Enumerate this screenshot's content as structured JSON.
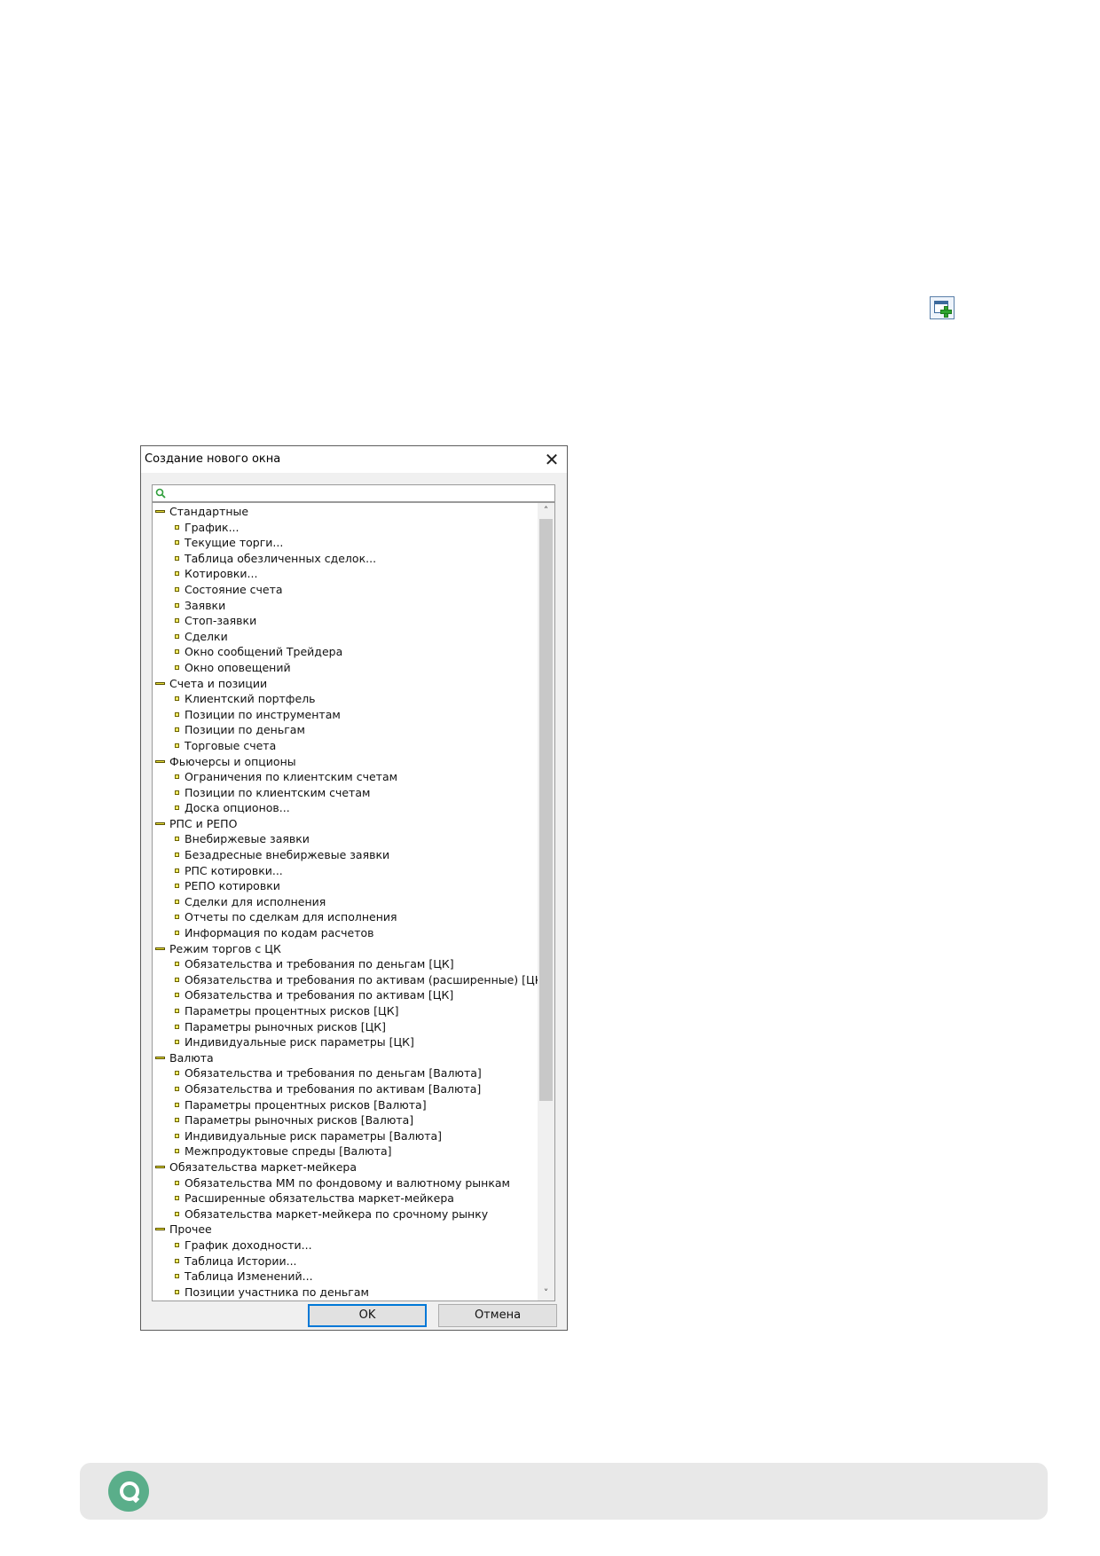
{
  "dialog": {
    "title": "Создание нового окна",
    "close_icon": "close-icon",
    "search_icon": "search-icon",
    "search_value": "",
    "ok_label": "OK",
    "cancel_label": "Отмена"
  },
  "tree": [
    {
      "type": "cat",
      "label": "Стандартные"
    },
    {
      "type": "leaf",
      "label": "График..."
    },
    {
      "type": "leaf",
      "label": "Текущие торги..."
    },
    {
      "type": "leaf",
      "label": "Таблица обезличенных сделок..."
    },
    {
      "type": "leaf",
      "label": "Котировки..."
    },
    {
      "type": "leaf",
      "label": "Состояние счета"
    },
    {
      "type": "leaf",
      "label": "Заявки"
    },
    {
      "type": "leaf",
      "label": "Стоп-заявки"
    },
    {
      "type": "leaf",
      "label": "Сделки"
    },
    {
      "type": "leaf",
      "label": "Окно сообщений Трейдера"
    },
    {
      "type": "leaf",
      "label": "Окно оповещений"
    },
    {
      "type": "cat",
      "label": "Счета и позиции"
    },
    {
      "type": "leaf",
      "label": "Клиентский портфель"
    },
    {
      "type": "leaf",
      "label": "Позиции по инструментам"
    },
    {
      "type": "leaf",
      "label": "Позиции по деньгам"
    },
    {
      "type": "leaf",
      "label": "Торговые счета"
    },
    {
      "type": "cat",
      "label": "Фьючерсы и опционы"
    },
    {
      "type": "leaf",
      "label": "Ограничения по клиентским счетам"
    },
    {
      "type": "leaf",
      "label": "Позиции по клиентским счетам"
    },
    {
      "type": "leaf",
      "label": "Доска опционов..."
    },
    {
      "type": "cat",
      "label": "РПС и РЕПО"
    },
    {
      "type": "leaf",
      "label": "Внебиржевые заявки"
    },
    {
      "type": "leaf",
      "label": "Безадресные внебиржевые заявки"
    },
    {
      "type": "leaf",
      "label": "РПС котировки..."
    },
    {
      "type": "leaf",
      "label": "РЕПО котировки"
    },
    {
      "type": "leaf",
      "label": "Сделки для исполнения"
    },
    {
      "type": "leaf",
      "label": "Отчеты по сделкам для исполнения"
    },
    {
      "type": "leaf",
      "label": "Информация по кодам расчетов"
    },
    {
      "type": "cat",
      "label": "Режим торгов с ЦК"
    },
    {
      "type": "leaf",
      "label": "Обязательства и требования по деньгам [ЦК]"
    },
    {
      "type": "leaf",
      "label": "Обязательства и требования по активам (расширенные) [ЦК]"
    },
    {
      "type": "leaf",
      "label": "Обязательства и требования по активам [ЦК]"
    },
    {
      "type": "leaf",
      "label": "Параметры процентных рисков [ЦК]"
    },
    {
      "type": "leaf",
      "label": "Параметры рыночных рисков [ЦК]"
    },
    {
      "type": "leaf",
      "label": "Индивидуальные риск параметры [ЦК]"
    },
    {
      "type": "cat",
      "label": "Валюта"
    },
    {
      "type": "leaf",
      "label": "Обязательства и требования по деньгам [Валюта]"
    },
    {
      "type": "leaf",
      "label": "Обязательства и требования по активам [Валюта]"
    },
    {
      "type": "leaf",
      "label": "Параметры процентных рисков [Валюта]"
    },
    {
      "type": "leaf",
      "label": "Параметры рыночных рисков [Валюта]"
    },
    {
      "type": "leaf",
      "label": "Индивидуальные риск параметры [Валюта]"
    },
    {
      "type": "leaf",
      "label": "Межпродуктовые спреды [Валюта]"
    },
    {
      "type": "cat",
      "label": "Обязательства маркет-мейкера"
    },
    {
      "type": "leaf",
      "label": "Обязательства ММ по фондовому и валютному рынкам"
    },
    {
      "type": "leaf",
      "label": "Расширенные обязательства маркет-мейкера"
    },
    {
      "type": "leaf",
      "label": "Обязательства маркет-мейкера по срочному рынку"
    },
    {
      "type": "cat",
      "label": "Прочее"
    },
    {
      "type": "leaf",
      "label": "График доходности..."
    },
    {
      "type": "leaf",
      "label": "Таблица Истории..."
    },
    {
      "type": "leaf",
      "label": "Таблица Изменений..."
    },
    {
      "type": "leaf",
      "label": "Позиции участника по деньгам"
    }
  ],
  "scrollbar": {
    "up_glyph": "˄",
    "down_glyph": "˅"
  },
  "toolbar": {
    "add_window_icon": "new-window-plus-icon"
  },
  "footer": {
    "logo_icon": "quik-logo-icon"
  }
}
